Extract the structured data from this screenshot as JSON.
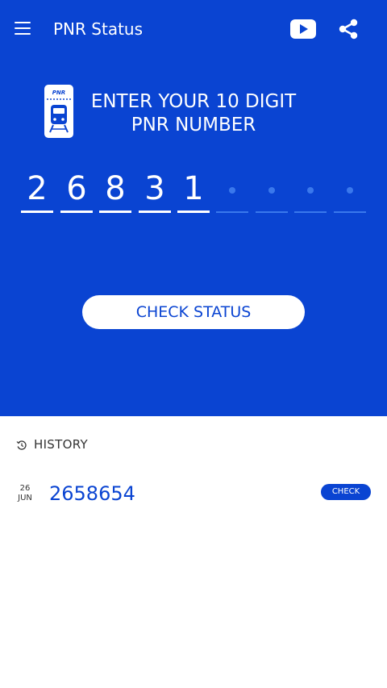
{
  "app_bar": {
    "title": "PNR Status",
    "icons": [
      "menu-icon",
      "youtube-icon",
      "share-icon"
    ]
  },
  "entry": {
    "ticket_icon_label": "PNR",
    "prompt_line1": "ENTER YOUR 10 DIGIT",
    "prompt_line2": "PNR NUMBER",
    "digits": [
      "2",
      "6",
      "8",
      "3",
      "1",
      "",
      "",
      "",
      "",
      ""
    ],
    "button_label": "CHECK STATUS"
  },
  "history": {
    "heading": "HISTORY",
    "items": [
      {
        "day": "26",
        "month": "JUN",
        "pnr": "2658654",
        "action": "CHECK"
      }
    ]
  },
  "colors": {
    "primary": "#0a44d2",
    "empty_slot": "#3a78ec",
    "text_dark": "#333333"
  }
}
